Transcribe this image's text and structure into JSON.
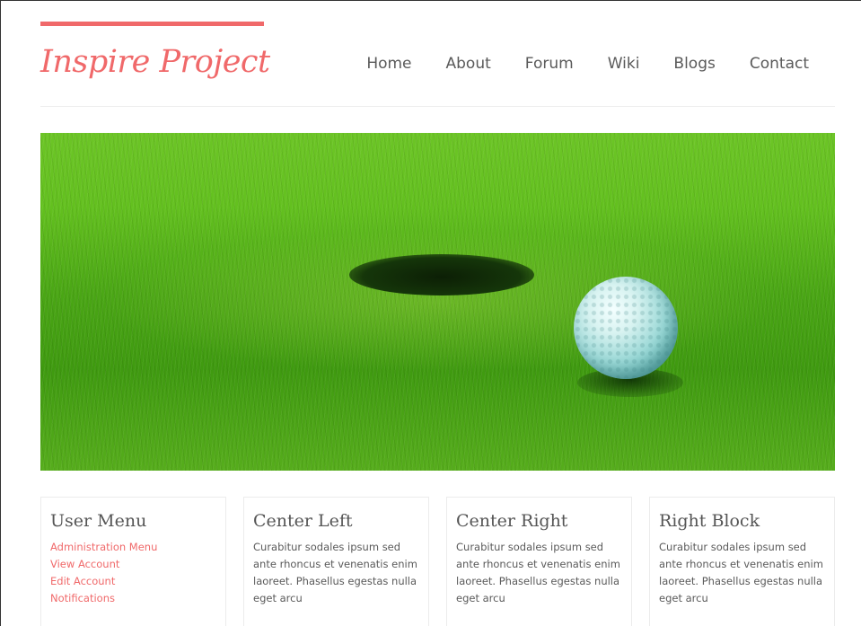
{
  "header": {
    "logo": "Inspire Project",
    "nav": [
      "Home",
      "About",
      "Forum",
      "Wiki",
      "Blogs",
      "Contact"
    ]
  },
  "colors": {
    "accent": "#f0696a",
    "text": "#555555",
    "grass": "#4aa615"
  },
  "hero": {
    "image": "golf-ball-near-hole"
  },
  "blocks": {
    "user_menu": {
      "title": "User Menu",
      "links": [
        "Administration Menu",
        "View Account",
        "Edit Account",
        "Notifications"
      ]
    },
    "center_left": {
      "title": "Center Left",
      "body": "Curabitur sodales ipsum sed ante rhoncus et venenatis enim laoreet. Phasellus egestas nulla eget arcu"
    },
    "center_right": {
      "title": "Center Right",
      "body": "Curabitur sodales ipsum sed ante rhoncus et venenatis enim laoreet. Phasellus egestas nulla eget arcu"
    },
    "right_block": {
      "title": "Right Block",
      "body": "Curabitur sodales ipsum sed ante rhoncus et venenatis enim laoreet. Phasellus egestas nulla eget arcu"
    }
  }
}
